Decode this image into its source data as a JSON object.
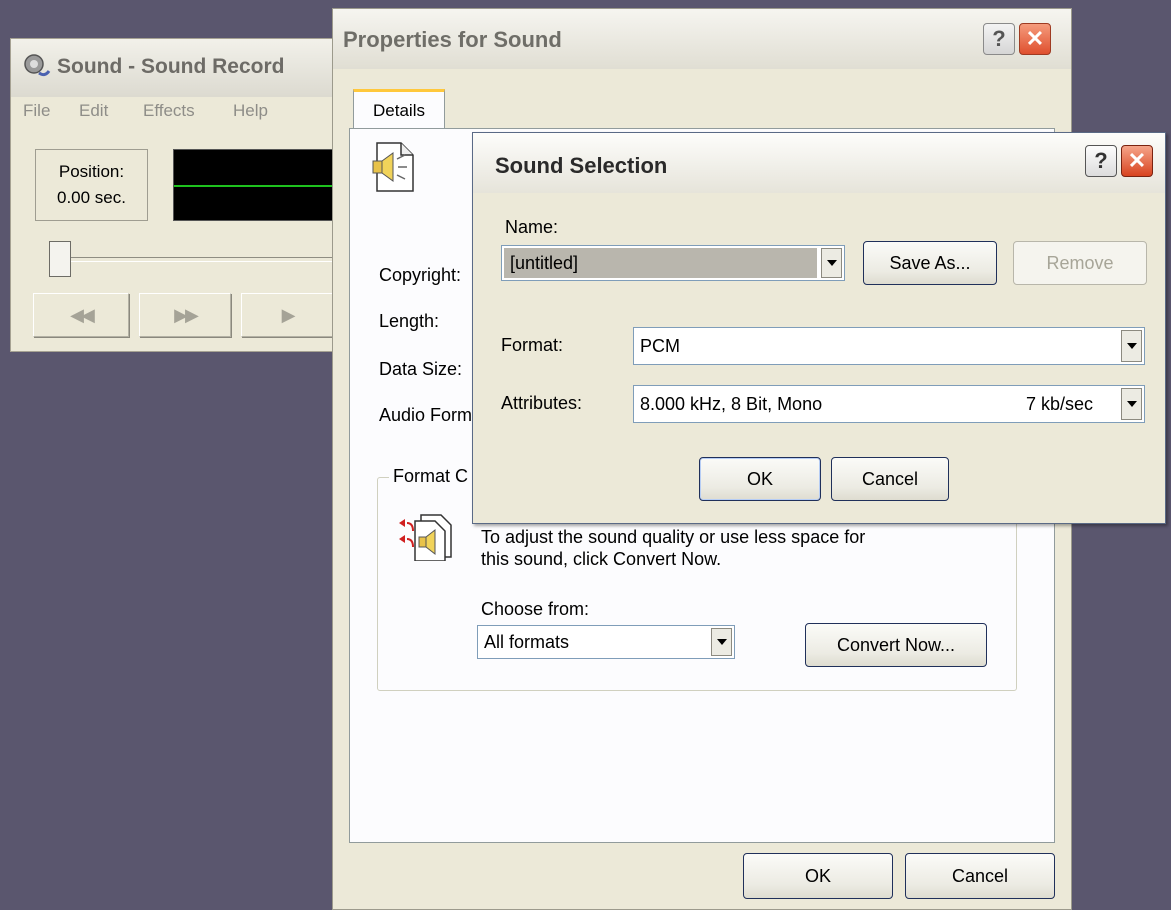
{
  "recorder": {
    "title": "Sound - Sound Record",
    "menu": [
      "File",
      "Edit",
      "Effects",
      "Help"
    ],
    "position_label": "Position:",
    "position_value": "0.00 sec.",
    "transport": [
      "◀◀",
      "▶▶",
      "▶"
    ],
    "slider_position": 0
  },
  "properties": {
    "title": "Properties for Sound",
    "tab": "Details",
    "labels": {
      "copyright": "Copyright:",
      "length": "Length:",
      "data_size": "Data Size:",
      "audio_format": "Audio Form"
    },
    "group_title": "Format C",
    "convert_text_1": "To adjust the sound quality or use less space for",
    "convert_text_2": "this sound, click Convert Now.",
    "choose_from_label": "Choose from:",
    "choose_from_value": "All formats",
    "convert_button": "Convert Now...",
    "ok_button": "OK",
    "cancel_button": "Cancel"
  },
  "selection": {
    "title": "Sound Selection",
    "name_label": "Name:",
    "name_value": "[untitled]",
    "save_as_button": "Save As...",
    "remove_button": "Remove",
    "format_label": "Format:",
    "format_value": "PCM",
    "attributes_label": "Attributes:",
    "attributes_value": "8.000 kHz, 8 Bit, Mono",
    "attributes_rate": "7 kb/sec",
    "ok_button": "OK",
    "cancel_button": "Cancel"
  },
  "titlebar_buttons": {
    "help": "?",
    "close": "✕"
  },
  "colors": {
    "desktop": "#5a566e",
    "dialog_face": "#ece9d8",
    "scope_trace": "#1ec21e",
    "close_red": "#df4f2e"
  }
}
